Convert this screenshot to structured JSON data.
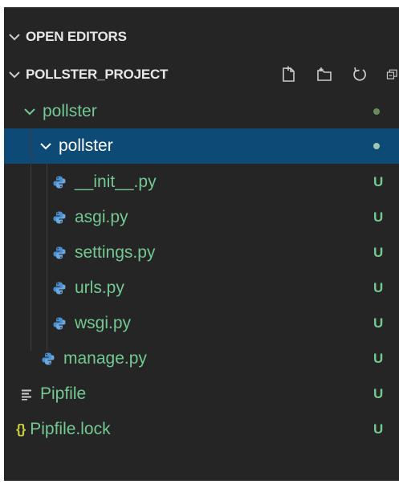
{
  "explorer": {
    "open_editors_title": "OPEN EDITORS",
    "project_title": "POLLSTER_PROJECT",
    "toolbar_icons": [
      "new-file-icon",
      "new-folder-icon",
      "refresh-icon",
      "collapse-all-icon"
    ]
  },
  "tree": {
    "root_folder": {
      "label": "pollster"
    },
    "sub_folder": {
      "label": "pollster"
    },
    "sub_files": [
      {
        "label": "__init__.py",
        "status": "U",
        "icon": "python-icon"
      },
      {
        "label": "asgi.py",
        "status": "U",
        "icon": "python-icon"
      },
      {
        "label": "settings.py",
        "status": "U",
        "icon": "python-icon"
      },
      {
        "label": "urls.py",
        "status": "U",
        "icon": "python-icon"
      },
      {
        "label": "wsgi.py",
        "status": "U",
        "icon": "python-icon"
      }
    ],
    "root_files": [
      {
        "label": "manage.py",
        "status": "U",
        "icon": "python-icon"
      },
      {
        "label": "Pipfile",
        "status": "U",
        "icon": "lines-icon"
      },
      {
        "label": "Pipfile.lock",
        "status": "U",
        "icon": "braces-icon",
        "glyph": "{}"
      }
    ]
  },
  "colors": {
    "background": "#252526",
    "selection": "#0e4a76",
    "untracked": "#73c991",
    "folder_text": "#73c991",
    "selected_text": "#ffffff",
    "python_icon": "#4a8fd0",
    "json_icon": "#cbcb41"
  }
}
